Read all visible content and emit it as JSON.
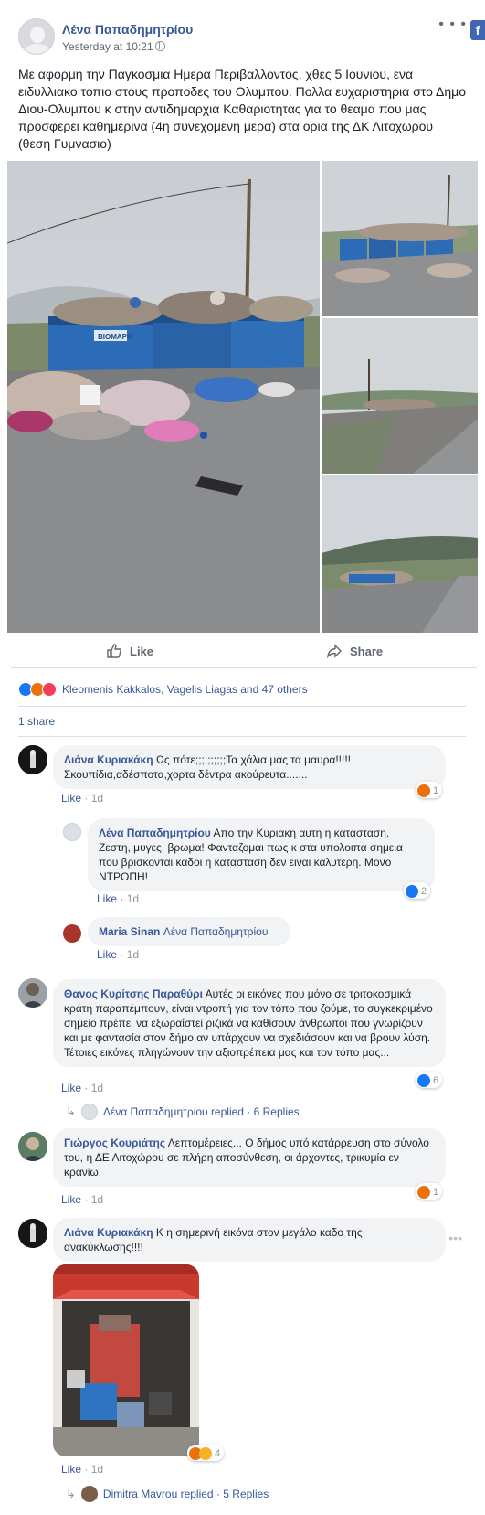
{
  "post": {
    "author": "Λένα Παπαδημητρίου",
    "time": "Yesterday at 10:21",
    "text": "Με αφορμη την Παγκοσμια Ημερα Περιβαλλοντος, χθες 5 Ιουνιου, ενα ειδυλλιακο τοπιο στους προποδες του Ολυμπου. Πολλα ευχαριστηρια στο Δημο Διου-Ολυμπου κ στην αντιδημαρχια Καθαριοτητας για το θεαμα που μας προσφερει καθημερινα (4η συνεχομενη μερα) στα ορια της ΔΚ Λιτοχωρου (θεση Γυμνασιο)",
    "bin_label": "ΒΙΟΜΑΡΚ"
  },
  "actions": {
    "like_label": "Like",
    "share_label": "Share"
  },
  "reactions": {
    "names": "Kleomenis Kakkalos, Vagelis Liagas and 47 others",
    "share_count": "1 share"
  },
  "comments": [
    {
      "name": "Λιάνα Κυριακάκη",
      "text": "Ως πότε;;;;;;;;;;Τα χάλια μας τα μαυρα!!!!!Σκουπίδια,αδέσποτα,χορτα δέντρα ακούρευτα.......",
      "like_label": "Like",
      "time": "1d",
      "reaction_count": "1"
    },
    {
      "name": "Λένα Παπαδημητρίου",
      "text": "Απο την Κυριακη αυτη η κατασταση. Ζεστη, μυγες, βρωμα! Φανταζομαι πως κ στα υπολοιπα σημεια που βρισκονται καδοι η κατασταση δεν ειναι καλυτερη. Μονο ΝΤΡΟΠΗ!",
      "like_label": "Like",
      "time": "1d",
      "reaction_count": "2"
    },
    {
      "name": "Maria Sinan",
      "text": "Λένα Παπαδημητρίου",
      "like_label": "Like",
      "time": "1d"
    },
    {
      "name": "Θανος Κυρίτσης Παραθύρι",
      "text": "Αυτές οι εικόνες που μόνο σε τριτοκοσμικά κράτη παραπέμπουν, είναι ντροπή για τον τόπο που ζούμε, το συγκεκριμένο σημείο πρέπει να εξωραΐστεί ριζικά να καθίσουν άνθρωποι που γνωρίζουν και με φαντασία στον δήμο αν υπάρχουν να σχεδιάσουν και να βρουν λύση. Τέτοιες εικόνες πληγώνουν την αξιοπρέπεια μας και τον τόπο μας...",
      "like_label": "Like",
      "time": "1d",
      "reaction_count": "6",
      "replied": "Λένα Παπαδημητρίου replied · 6 Replies"
    },
    {
      "name": "Γιώργος Κουριάτης",
      "text": "Λεπτομέρειες... Ο δήμος υπό κατάρρευση στο σύνολο του, η ΔΕ Λιτοχώρου σε πλήρη αποσύνθεση, οι άρχοντες, τρικυμία εν κρανίω.",
      "like_label": "Like",
      "time": "1d",
      "reaction_count": "1"
    },
    {
      "name": "Λιάνα Κυριακάκη",
      "text": "Κ η σημερινή εικόνα στον μεγάλο καδο της ανακύκλωσης!!!!",
      "like_label": "Like",
      "time": "1d",
      "reaction_count": "4",
      "replied": "Dimitra Mavrou replied · 5 Replies"
    }
  ],
  "icons": {
    "more": "more-options-icon",
    "globe": "globe-icon",
    "like": "thumbs-up-icon",
    "share": "share-arrow-icon",
    "facebook": "facebook-icon"
  },
  "colors": {
    "link": "#385898",
    "like_blue": "#1877f2",
    "angry": "#e9710f",
    "love": "#f33e58"
  }
}
